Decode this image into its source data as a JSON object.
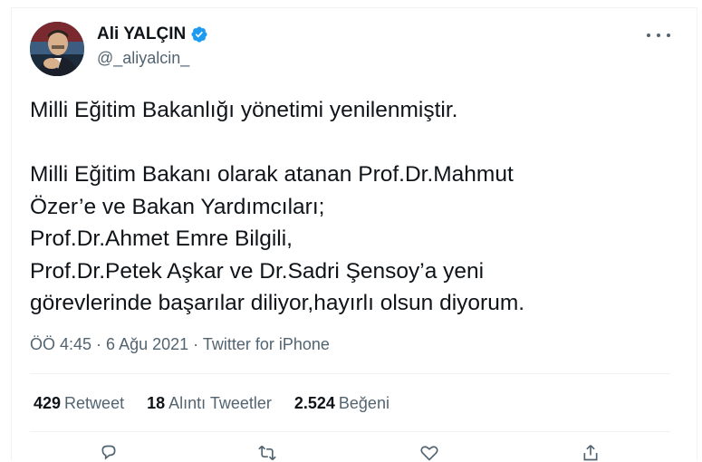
{
  "author": {
    "name": "Ali YALÇIN",
    "handle": "@_aliyalcin_"
  },
  "tweet": {
    "lines": [
      "Milli Eğitim Bakanlığı yönetimi yenilenmiştir.",
      "",
      "Milli Eğitim Bakanı olarak atanan Prof.Dr.Mahmut",
      "Özer’e ve Bakan Yardımcıları;",
      "Prof.Dr.Ahmet Emre Bilgili,",
      "Prof.Dr.Petek Aşkar ve Dr.Sadri Şensoy’a yeni",
      "görevlerinde başarılar diliyor,hayırlı olsun diyorum."
    ]
  },
  "meta": {
    "time": "ÖÖ 4:45",
    "separator1": " · ",
    "date": "6 Ağu 2021",
    "separator2": " · ",
    "source": "Twitter for iPhone"
  },
  "stats": {
    "retweets_count": "429",
    "retweets_label": "Retweet",
    "quotes_count": "18",
    "quotes_label": "Alıntı Tweetler",
    "likes_count": "2.524",
    "likes_label": "Beğeni"
  },
  "icons": {
    "verified": "verified-badge-icon",
    "more": "more-horizontal-icon",
    "reply": "reply-icon",
    "retweet": "retweet-icon",
    "like": "heart-icon",
    "share": "share-icon"
  },
  "colors": {
    "accent": "#1d9bf0",
    "secondary_text": "#536471",
    "primary_text": "#0f1419",
    "divider": "#eff3f4"
  }
}
